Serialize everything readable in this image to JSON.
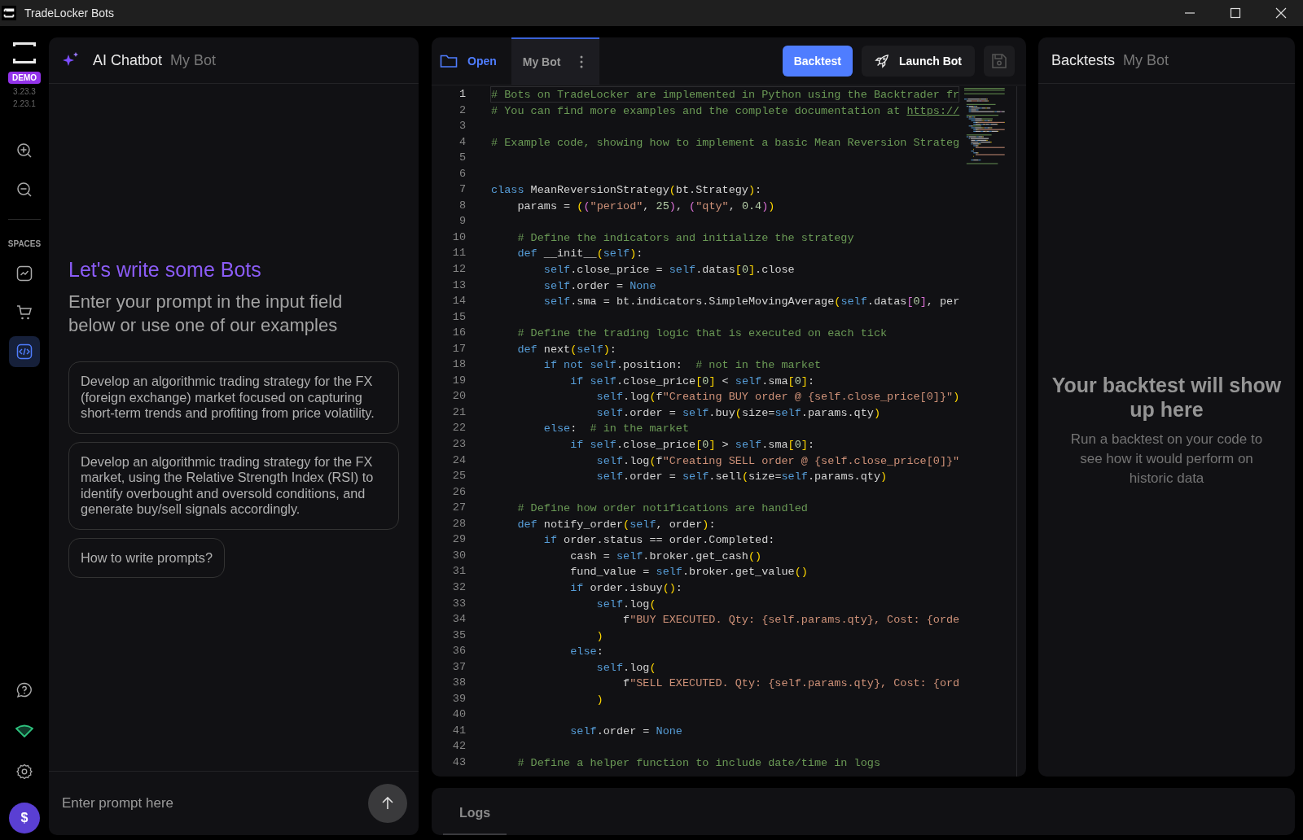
{
  "window": {
    "title": "TradeLocker Bots"
  },
  "sidebar": {
    "badge": "DEMO",
    "versions": [
      "3.23.3",
      "2.23.1"
    ],
    "section_label": "SPACES",
    "spaces": [
      {
        "kind": "chart",
        "selected": false
      },
      {
        "kind": "cart",
        "selected": false
      },
      {
        "kind": "code",
        "selected": true
      }
    ],
    "account_button": "$"
  },
  "chat": {
    "title": "AI Chatbot",
    "subtitle": "My Bot",
    "heading": "Let's write some Bots",
    "intro": "Enter your prompt in the input field below or use one of our examples",
    "examples": [
      "Develop an algorithmic trading strategy for the FX (foreign exchange) market focused on capturing short-term trends and profiting from price volatility.",
      "Develop an algorithmic trading strategy for the FX market, using the Relative Strength Index (RSI) to identify overbought and oversold conditions, and generate buy/sell signals accordingly.",
      "How to write prompts?"
    ],
    "input": {
      "placeholder": "Enter prompt here"
    }
  },
  "editor": {
    "tabs": [
      {
        "label": "Open",
        "kind": "open",
        "selected": false
      },
      {
        "label": "My Bot",
        "kind": "file",
        "selected": true
      }
    ],
    "buttons": [
      {
        "label": "Backtest",
        "kind": "primary"
      },
      {
        "label": "Launch Bot",
        "kind": "launch"
      },
      {
        "kind": "save"
      }
    ],
    "lines": [
      {
        "number": "1",
        "current": true,
        "tokens": [
          {
            "kind": "comment",
            "text": "# Bots on TradeLocker are implemented in Python using the Backtrader fr"
          }
        ]
      },
      {
        "number": "2",
        "current": false,
        "tokens": [
          {
            "kind": "comment",
            "text": "# You can find more examples and the complete documentation at "
          },
          {
            "kind": "link",
            "text": "https://"
          }
        ]
      },
      {
        "number": "3",
        "current": false
      },
      {
        "number": "4",
        "current": false,
        "tokens": [
          {
            "kind": "comment",
            "text": "# Example code, showing how to implement a basic Mean Reversion Strateg"
          }
        ]
      },
      {
        "number": "5",
        "current": false
      },
      {
        "number": "6",
        "current": false
      },
      {
        "number": "7",
        "current": false,
        "tokens": [
          {
            "kind": "keyword",
            "text": "class"
          },
          {
            "kind": "plain",
            "text": " MeanReversionStrategy"
          },
          {
            "kind": "bracket",
            "text": "("
          },
          {
            "kind": "plain",
            "text": "bt.Strategy"
          },
          {
            "kind": "bracket",
            "text": ")"
          },
          {
            "kind": "plain",
            "text": ":"
          }
        ]
      },
      {
        "number": "8",
        "current": false,
        "tokens": [
          {
            "kind": "plain",
            "text": "    params = "
          },
          {
            "kind": "bracket",
            "text": "("
          },
          {
            "kind": "bracket2",
            "text": "("
          },
          {
            "kind": "string",
            "text": "\"period\""
          },
          {
            "kind": "plain",
            "text": ", "
          },
          {
            "kind": "number",
            "text": "25"
          },
          {
            "kind": "bracket2",
            "text": ")"
          },
          {
            "kind": "plain",
            "text": ", "
          },
          {
            "kind": "bracket2",
            "text": "("
          },
          {
            "kind": "string",
            "text": "\"qty\""
          },
          {
            "kind": "plain",
            "text": ", "
          },
          {
            "kind": "number",
            "text": "0.4"
          },
          {
            "kind": "bracket2",
            "text": ")"
          },
          {
            "kind": "bracket",
            "text": ")"
          }
        ]
      },
      {
        "number": "9",
        "current": false
      },
      {
        "number": "10",
        "current": false,
        "tokens": [
          {
            "kind": "comment",
            "text": "    # Define the indicators and initialize the strategy"
          }
        ]
      },
      {
        "number": "11",
        "current": false,
        "tokens": [
          {
            "kind": "keyword",
            "text": "    def"
          },
          {
            "kind": "plain",
            "text": " __init__"
          },
          {
            "kind": "bracket",
            "text": "("
          },
          {
            "kind": "keyword",
            "text": "self"
          },
          {
            "kind": "bracket",
            "text": ")"
          },
          {
            "kind": "plain",
            "text": ":"
          }
        ]
      },
      {
        "number": "12",
        "current": false,
        "tokens": [
          {
            "kind": "keyword",
            "text": "        self"
          },
          {
            "kind": "plain",
            "text": ".close_price = "
          },
          {
            "kind": "keyword",
            "text": "self"
          },
          {
            "kind": "plain",
            "text": ".datas"
          },
          {
            "kind": "bracket",
            "text": "["
          },
          {
            "kind": "number",
            "text": "0"
          },
          {
            "kind": "bracket",
            "text": "]"
          },
          {
            "kind": "plain",
            "text": ".close"
          }
        ]
      },
      {
        "number": "13",
        "current": false,
        "tokens": [
          {
            "kind": "keyword",
            "text": "        self"
          },
          {
            "kind": "plain",
            "text": ".order = "
          },
          {
            "kind": "keyword",
            "text": "None"
          }
        ]
      },
      {
        "number": "14",
        "current": false,
        "tokens": [
          {
            "kind": "keyword",
            "text": "        self"
          },
          {
            "kind": "plain",
            "text": ".sma = bt.indicators.SimpleMovingAverage"
          },
          {
            "kind": "bracket",
            "text": "("
          },
          {
            "kind": "keyword",
            "text": "self"
          },
          {
            "kind": "plain",
            "text": ".datas"
          },
          {
            "kind": "bracket2",
            "text": "["
          },
          {
            "kind": "number",
            "text": "0"
          },
          {
            "kind": "bracket2",
            "text": "]"
          },
          {
            "kind": "plain",
            "text": ", per"
          }
        ]
      },
      {
        "number": "15",
        "current": false
      },
      {
        "number": "16",
        "current": false,
        "tokens": [
          {
            "kind": "comment",
            "text": "    # Define the trading logic that is executed on each tick"
          }
        ]
      },
      {
        "number": "17",
        "current": false,
        "tokens": [
          {
            "kind": "keyword",
            "text": "    def"
          },
          {
            "kind": "plain",
            "text": " next"
          },
          {
            "kind": "bracket",
            "text": "("
          },
          {
            "kind": "keyword",
            "text": "self"
          },
          {
            "kind": "bracket",
            "text": ")"
          },
          {
            "kind": "plain",
            "text": ":"
          }
        ]
      },
      {
        "number": "18",
        "current": false,
        "tokens": [
          {
            "kind": "keyword",
            "text": "        if not self"
          },
          {
            "kind": "plain",
            "text": ".position:  "
          },
          {
            "kind": "comment",
            "text": "# not in the market"
          }
        ]
      },
      {
        "number": "19",
        "current": false,
        "tokens": [
          {
            "kind": "keyword",
            "text": "            if self"
          },
          {
            "kind": "plain",
            "text": ".close_price"
          },
          {
            "kind": "bracket",
            "text": "["
          },
          {
            "kind": "number",
            "text": "0"
          },
          {
            "kind": "bracket",
            "text": "]"
          },
          {
            "kind": "plain",
            "text": " < "
          },
          {
            "kind": "keyword",
            "text": "self"
          },
          {
            "kind": "plain",
            "text": ".sma"
          },
          {
            "kind": "bracket",
            "text": "["
          },
          {
            "kind": "number",
            "text": "0"
          },
          {
            "kind": "bracket",
            "text": "]"
          },
          {
            "kind": "plain",
            "text": ":"
          }
        ]
      },
      {
        "number": "20",
        "current": false,
        "tokens": [
          {
            "kind": "keyword",
            "text": "                self"
          },
          {
            "kind": "plain",
            "text": ".log"
          },
          {
            "kind": "bracket",
            "text": "("
          },
          {
            "kind": "plain",
            "text": "f"
          },
          {
            "kind": "string",
            "text": "\"Creating BUY order @ {self.close_price[0]}\""
          },
          {
            "kind": "bracket",
            "text": ")"
          }
        ]
      },
      {
        "number": "21",
        "current": false,
        "tokens": [
          {
            "kind": "keyword",
            "text": "                self"
          },
          {
            "kind": "plain",
            "text": ".order = "
          },
          {
            "kind": "keyword",
            "text": "self"
          },
          {
            "kind": "plain",
            "text": ".buy"
          },
          {
            "kind": "bracket",
            "text": "("
          },
          {
            "kind": "plain",
            "text": "size="
          },
          {
            "kind": "keyword",
            "text": "self"
          },
          {
            "kind": "plain",
            "text": ".params.qty"
          },
          {
            "kind": "bracket",
            "text": ")"
          }
        ]
      },
      {
        "number": "22",
        "current": false,
        "tokens": [
          {
            "kind": "keyword",
            "text": "        else"
          },
          {
            "kind": "plain",
            "text": ":  "
          },
          {
            "kind": "comment",
            "text": "# in the market"
          }
        ]
      },
      {
        "number": "23",
        "current": false,
        "tokens": [
          {
            "kind": "keyword",
            "text": "            if self"
          },
          {
            "kind": "plain",
            "text": ".close_price"
          },
          {
            "kind": "bracket",
            "text": "["
          },
          {
            "kind": "number",
            "text": "0"
          },
          {
            "kind": "bracket",
            "text": "]"
          },
          {
            "kind": "plain",
            "text": " > "
          },
          {
            "kind": "keyword",
            "text": "self"
          },
          {
            "kind": "plain",
            "text": ".sma"
          },
          {
            "kind": "bracket",
            "text": "["
          },
          {
            "kind": "number",
            "text": "0"
          },
          {
            "kind": "bracket",
            "text": "]"
          },
          {
            "kind": "plain",
            "text": ":"
          }
        ]
      },
      {
        "number": "24",
        "current": false,
        "tokens": [
          {
            "kind": "keyword",
            "text": "                self"
          },
          {
            "kind": "plain",
            "text": ".log"
          },
          {
            "kind": "bracket",
            "text": "("
          },
          {
            "kind": "plain",
            "text": "f"
          },
          {
            "kind": "string",
            "text": "\"Creating SELL order @ {self.close_price[0]}\""
          }
        ]
      },
      {
        "number": "25",
        "current": false,
        "tokens": [
          {
            "kind": "keyword",
            "text": "                self"
          },
          {
            "kind": "plain",
            "text": ".order = "
          },
          {
            "kind": "keyword",
            "text": "self"
          },
          {
            "kind": "plain",
            "text": ".sell"
          },
          {
            "kind": "bracket",
            "text": "("
          },
          {
            "kind": "plain",
            "text": "size="
          },
          {
            "kind": "keyword",
            "text": "self"
          },
          {
            "kind": "plain",
            "text": ".params.qty"
          },
          {
            "kind": "bracket",
            "text": ")"
          }
        ]
      },
      {
        "number": "26",
        "current": false
      },
      {
        "number": "27",
        "current": false,
        "tokens": [
          {
            "kind": "comment",
            "text": "    # Define how order notifications are handled"
          }
        ]
      },
      {
        "number": "28",
        "current": false,
        "tokens": [
          {
            "kind": "keyword",
            "text": "    def"
          },
          {
            "kind": "plain",
            "text": " notify_order"
          },
          {
            "kind": "bracket",
            "text": "("
          },
          {
            "kind": "keyword",
            "text": "self"
          },
          {
            "kind": "plain",
            "text": ", order"
          },
          {
            "kind": "bracket",
            "text": ")"
          },
          {
            "kind": "plain",
            "text": ":"
          }
        ]
      },
      {
        "number": "29",
        "current": false,
        "tokens": [
          {
            "kind": "keyword",
            "text": "        if"
          },
          {
            "kind": "plain",
            "text": " order.status == order.Completed:"
          }
        ]
      },
      {
        "number": "30",
        "current": false,
        "tokens": [
          {
            "kind": "plain",
            "text": "            cash = "
          },
          {
            "kind": "keyword",
            "text": "self"
          },
          {
            "kind": "plain",
            "text": ".broker.get_cash"
          },
          {
            "kind": "bracket",
            "text": "()"
          }
        ]
      },
      {
        "number": "31",
        "current": false,
        "tokens": [
          {
            "kind": "plain",
            "text": "            fund_value = "
          },
          {
            "kind": "keyword",
            "text": "self"
          },
          {
            "kind": "plain",
            "text": ".broker.get_value"
          },
          {
            "kind": "bracket",
            "text": "()"
          }
        ]
      },
      {
        "number": "32",
        "current": false,
        "tokens": [
          {
            "kind": "keyword",
            "text": "            if"
          },
          {
            "kind": "plain",
            "text": " order.isbuy"
          },
          {
            "kind": "bracket",
            "text": "()"
          },
          {
            "kind": "plain",
            "text": ":"
          }
        ]
      },
      {
        "number": "33",
        "current": false,
        "tokens": [
          {
            "kind": "keyword",
            "text": "                self"
          },
          {
            "kind": "plain",
            "text": ".log"
          },
          {
            "kind": "bracket",
            "text": "("
          }
        ]
      },
      {
        "number": "34",
        "current": false,
        "tokens": [
          {
            "kind": "plain",
            "text": "                    f"
          },
          {
            "kind": "string",
            "text": "\"BUY EXECUTED. Qty: {self.params.qty}, Cost: {orde"
          }
        ]
      },
      {
        "number": "35",
        "current": false,
        "tokens": [
          {
            "kind": "bracket",
            "text": "                )"
          }
        ]
      },
      {
        "number": "36",
        "current": false,
        "tokens": [
          {
            "kind": "keyword",
            "text": "            else"
          },
          {
            "kind": "plain",
            "text": ":"
          }
        ]
      },
      {
        "number": "37",
        "current": false,
        "tokens": [
          {
            "kind": "keyword",
            "text": "                self"
          },
          {
            "kind": "plain",
            "text": ".log"
          },
          {
            "kind": "bracket",
            "text": "("
          }
        ]
      },
      {
        "number": "38",
        "current": false,
        "tokens": [
          {
            "kind": "plain",
            "text": "                    f"
          },
          {
            "kind": "string",
            "text": "\"SELL EXECUTED. Qty: {self.params.qty}, Cost: {ord"
          }
        ]
      },
      {
        "number": "39",
        "current": false,
        "tokens": [
          {
            "kind": "bracket",
            "text": "                )"
          }
        ]
      },
      {
        "number": "40",
        "current": false
      },
      {
        "number": "41",
        "current": false,
        "tokens": [
          {
            "kind": "keyword",
            "text": "            self"
          },
          {
            "kind": "plain",
            "text": ".order = "
          },
          {
            "kind": "keyword",
            "text": "None"
          }
        ]
      },
      {
        "number": "42",
        "current": false
      },
      {
        "number": "43",
        "current": false,
        "tokens": [
          {
            "kind": "comment",
            "text": "    # Define a helper function to include date/time in logs"
          }
        ]
      }
    ]
  },
  "backtests": {
    "title": "Backtests",
    "subtitle": "My Bot",
    "empty_title": "Your backtest will show up here",
    "empty_text": "Run a backtest on your code to see how it would perform on historic data"
  },
  "logs": {
    "tabs": [
      {
        "label": "Logs",
        "selected": true
      }
    ]
  }
}
